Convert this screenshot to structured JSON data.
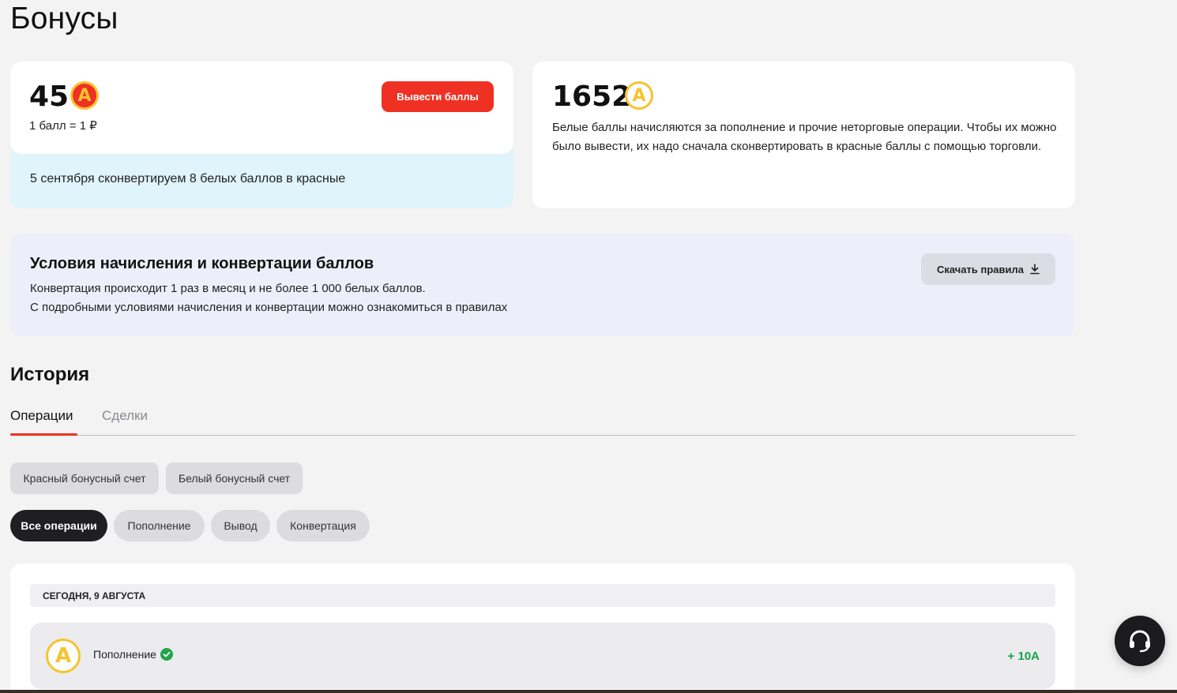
{
  "page": {
    "title": "Бонусы"
  },
  "red_balance": {
    "amount": "45",
    "coin_letter": "A",
    "rate": "1 балл = 1 ₽",
    "withdraw_label": "Вывести баллы",
    "conversion_note": "5 сентября сконвертируем 8 белых баллов в красные"
  },
  "white_balance": {
    "amount": "1652",
    "coin_letter": "A",
    "description": "Белые баллы начисляются за пополнение и прочие неторговые операции. Чтобы их можно было вывести, их надо сначала сконвертировать в красные баллы с помощью торговли."
  },
  "rules": {
    "title": "Условия начисления и конвертации баллов",
    "line1": "Конвертация происходит 1 раз в месяц и не более 1 000 белых баллов.",
    "line2": "С подробными условиями начисления и конвертации можно ознакомиться в правилах",
    "download_label": "Скачать правила"
  },
  "history": {
    "title": "История",
    "tabs": [
      {
        "label": "Операции",
        "active": true
      },
      {
        "label": "Сделки",
        "active": false
      }
    ],
    "accounts": [
      {
        "label": "Красный бонусный счет"
      },
      {
        "label": "Белый бонусный счет"
      }
    ],
    "filters": [
      {
        "label": "Все операции",
        "active": true
      },
      {
        "label": "Пополнение",
        "active": false
      },
      {
        "label": "Вывод",
        "active": false
      },
      {
        "label": "Конвертация",
        "active": false
      }
    ],
    "date_header": "СЕГОДНЯ, 9 АВГУСТА",
    "operations": [
      {
        "coin_letter": "A",
        "name": "Пополнение",
        "amount": "+ 10A"
      }
    ]
  },
  "icons": {
    "download": "download-icon",
    "check": "check-circle-icon",
    "support": "headset-icon"
  },
  "colors": {
    "accent_red": "#ef3124",
    "coin_gold": "#f7c32e",
    "success_green": "#16a34a"
  }
}
